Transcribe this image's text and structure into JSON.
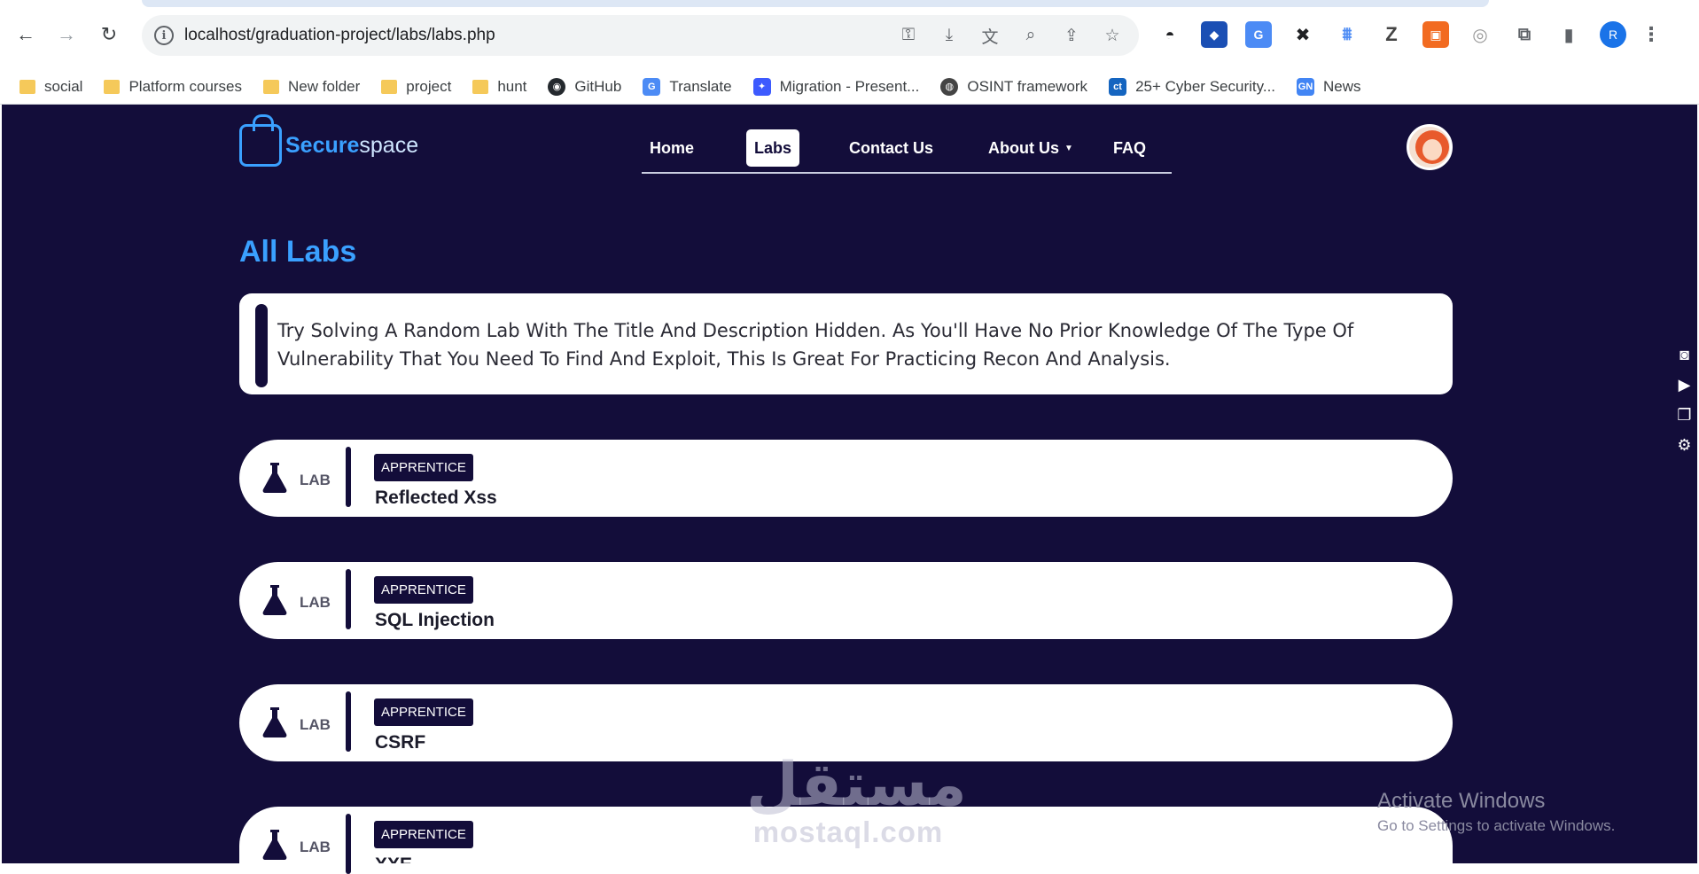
{
  "browser": {
    "url": "localhost/graduation-project/labs/labs.php",
    "bookmarks": [
      {
        "label": "social",
        "icon": "folder-icon"
      },
      {
        "label": "Platform courses",
        "icon": "folder-icon"
      },
      {
        "label": "New folder",
        "icon": "folder-icon"
      },
      {
        "label": "project",
        "icon": "folder-icon"
      },
      {
        "label": "hunt",
        "icon": "folder-icon"
      },
      {
        "label": "GitHub",
        "icon": "github-icon"
      },
      {
        "label": "Translate",
        "icon": "translate-icon"
      },
      {
        "label": "Migration - Present...",
        "icon": "migration-icon"
      },
      {
        "label": "OSINT framework",
        "icon": "globe-icon"
      },
      {
        "label": "25+ Cyber Security...",
        "icon": "ct-icon"
      },
      {
        "label": "News",
        "icon": "news-icon"
      }
    ],
    "profile_initial": "R"
  },
  "site": {
    "logo_part1": "Secure",
    "logo_part2": "space",
    "nav": {
      "home": "Home",
      "labs": "Labs",
      "contact": "Contact Us",
      "about": "About Us",
      "faq": "FAQ"
    }
  },
  "main": {
    "title": "All Labs",
    "description": "Try Solving A Random Lab With The Title And Description Hidden. As You'll Have No Prior Knowledge Of The Type Of Vulnerability That You Need To Find And Exploit, This Is Great For Practicing Recon And Analysis.",
    "labs": [
      {
        "type_label": "LAB",
        "level": "APPRENTICE",
        "name": "Reflected Xss"
      },
      {
        "type_label": "LAB",
        "level": "APPRENTICE",
        "name": "SQL Injection"
      },
      {
        "type_label": "LAB",
        "level": "APPRENTICE",
        "name": "CSRF"
      },
      {
        "type_label": "LAB",
        "level": "APPRENTICE",
        "name": "XXE"
      }
    ]
  },
  "overlay": {
    "watermark_ar": "مستقل",
    "watermark_en": "mostaql.com",
    "activate_title": "Activate Windows",
    "activate_sub": "Go to Settings to activate Windows."
  },
  "colors": {
    "page_bg": "#130d3a",
    "accent": "#3aa0ff"
  }
}
